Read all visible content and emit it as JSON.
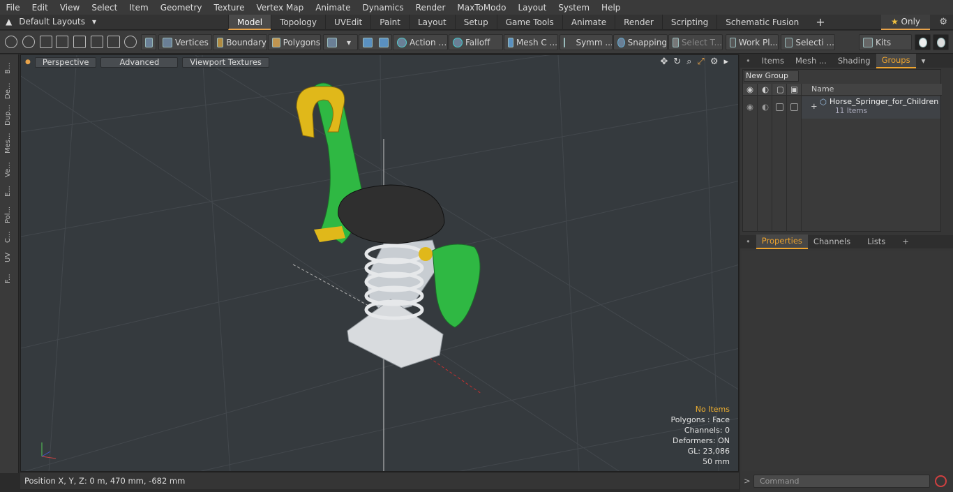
{
  "menu": [
    "File",
    "Edit",
    "View",
    "Select",
    "Item",
    "Geometry",
    "Texture",
    "Vertex Map",
    "Animate",
    "Dynamics",
    "Render",
    "MaxToModo",
    "Layout",
    "System",
    "Help"
  ],
  "layout_select": "Default Layouts",
  "tabs": [
    "Model",
    "Topology",
    "UVEdit",
    "Paint",
    "Layout",
    "Setup",
    "Game Tools",
    "Animate",
    "Render",
    "Scripting",
    "Schematic Fusion"
  ],
  "only_label": "Only",
  "toolbar": {
    "vertices": "Vertices",
    "boundary": "Boundary",
    "polygons": "Polygons",
    "action": "Action",
    "falloff": "Falloff",
    "meshc": "Mesh C ...",
    "symm": "Symm ...",
    "snapping": "Snapping",
    "selectt": "Select T...",
    "workpl": "Work Pl...",
    "selecti": "Selecti ...",
    "kits": "Kits"
  },
  "left_tabs": [
    "B...",
    "De...",
    "Dup...",
    "Mes...",
    "Ve...",
    "E...",
    "Pol...",
    "C...",
    "UV",
    "F..."
  ],
  "viewport": {
    "perspective": "Perspective",
    "advanced": "Advanced",
    "textures": "Viewport Textures",
    "info": {
      "items": "No Items",
      "polygons": "Polygons : Face",
      "channels": "Channels: 0",
      "deformers": "Deformers: ON",
      "gl": "GL: 23,086",
      "size": "50 mm"
    }
  },
  "status": "Position X, Y, Z:   0 m, 470 mm, -682 mm",
  "right_tabs": [
    "Items",
    "Mesh ...",
    "Shading",
    "Groups"
  ],
  "new_group": "New Group",
  "name_col": "Name",
  "group_name": "Horse_Springer_for_Children ...",
  "group_count": "11 Items",
  "prop_tabs": [
    "Properties",
    "Channels",
    "Lists"
  ],
  "command_placeholder": "Command"
}
